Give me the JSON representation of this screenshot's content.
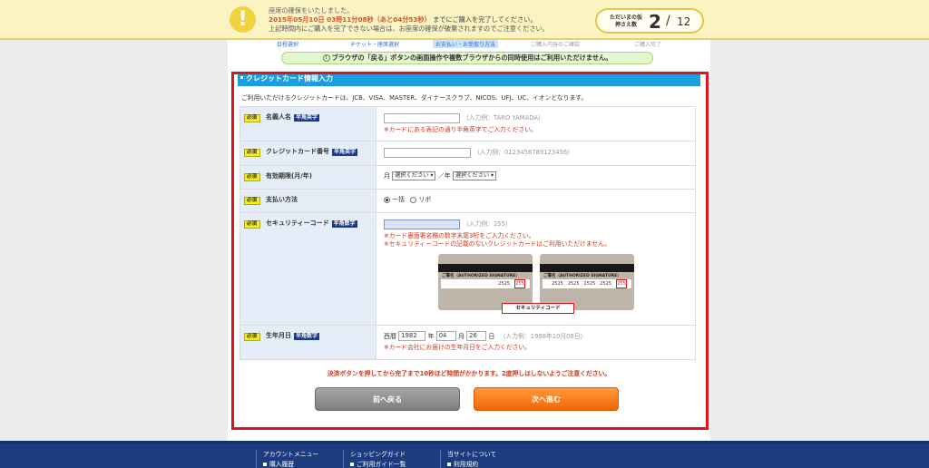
{
  "notice": {
    "icon": "exclamation-icon",
    "line1": "座席の確保をいたしました。",
    "line2_date": "2015年05月10日 03時11分08秒（あと04分53秒）",
    "line2_rest": "までにご購入を完了してください。",
    "line3": "上記時間内にご購入を完了できない場合は、お座席の確保が破棄されますのでご注意ください。"
  },
  "counter": {
    "label": "ただいまの仮押さえ数",
    "current": "2",
    "sep": "/",
    "total": "12"
  },
  "steps": [
    {
      "label": "日程選択",
      "state": "done"
    },
    {
      "label": "チケット・座席選択",
      "state": "done"
    },
    {
      "label": "お支払い・お受取り方法",
      "state": "current"
    },
    {
      "label": "ご購入内容のご確認",
      "state": "todo"
    },
    {
      "label": "ご購入完了",
      "state": "todo"
    }
  ],
  "browser_warning": "ブラウザの「戻る」ボタンの画面操作や複数ブラウザからの同時使用はご利用いただけません。",
  "section_title": "クレジットカード情報入力",
  "intro": "ご利用いただけるクレジットカードは、JCB、VISA、MASTER、ダイナースクラブ、NICOS、UFJ、UC、イオンとなります。",
  "required_label": "必須",
  "fields": {
    "name": {
      "label": "名義人名",
      "tag": "半角英字",
      "placeholder": "（入力例：TARO YAMADA）",
      "note": "※カードにある表記の通り半角英字でご入力ください。"
    },
    "card_number": {
      "label": "クレジットカード番号",
      "tag": "半角英字",
      "placeholder": "（入力例：0123456789123456）"
    },
    "expiry": {
      "label": "有効期限(月/年)",
      "month_label": "月",
      "month_value": "選択ください",
      "year_label": "／年",
      "year_value": "選択ください"
    },
    "payment": {
      "label": "支払い方法",
      "options": [
        "一括",
        "リボ"
      ],
      "selected": "一括"
    },
    "security": {
      "label": "セキュリティーコード",
      "tag": "半角数字",
      "placeholder": "（入力例：255）",
      "note1": "※カード裏面署名欄の数字末尾3桁をご入力ください。",
      "note2": "※セキュリティーコードの記載のないクレジットカードはご利用いただけません。",
      "card_sig_label": "ご署名（AUTHORIZED SIGNATURE）",
      "card1_digits": "2525",
      "card2_digits": "2525　2525　2525　2525",
      "cvv": "255",
      "cvv_label": "セキュリティコード"
    },
    "birthday": {
      "label": "生年月日",
      "tag": "半角数字",
      "era": "西暦",
      "year": "1982",
      "year_unit": "年",
      "month": "04",
      "month_unit": "月",
      "day": "26",
      "day_unit": "日",
      "placeholder": "（入力例：1998年10月08日）",
      "note": "※カード会社にお届けの生年月日をご入力ください。"
    }
  },
  "submit_warning": "決済ボタンを押してから完了まで10秒ほど時間がかかります。2度押しはしないようご注意ください。",
  "buttons": {
    "back": "前へ戻る",
    "next": "次へ進む"
  },
  "footer": {
    "col1_title": "アカウントメニュー",
    "col1_sub": "購入履歴",
    "col2_title": "ショッピングガイド",
    "col2_sub": "ご利用ガイド一覧",
    "col3_title": "当サイトについて",
    "col3_sub": "利用規約"
  },
  "colors": {
    "accent_blue": "#1a9ee0",
    "cta_orange": "#f0660a",
    "highlight_red": "#e1141c",
    "footer_navy": "#1c3c80"
  }
}
